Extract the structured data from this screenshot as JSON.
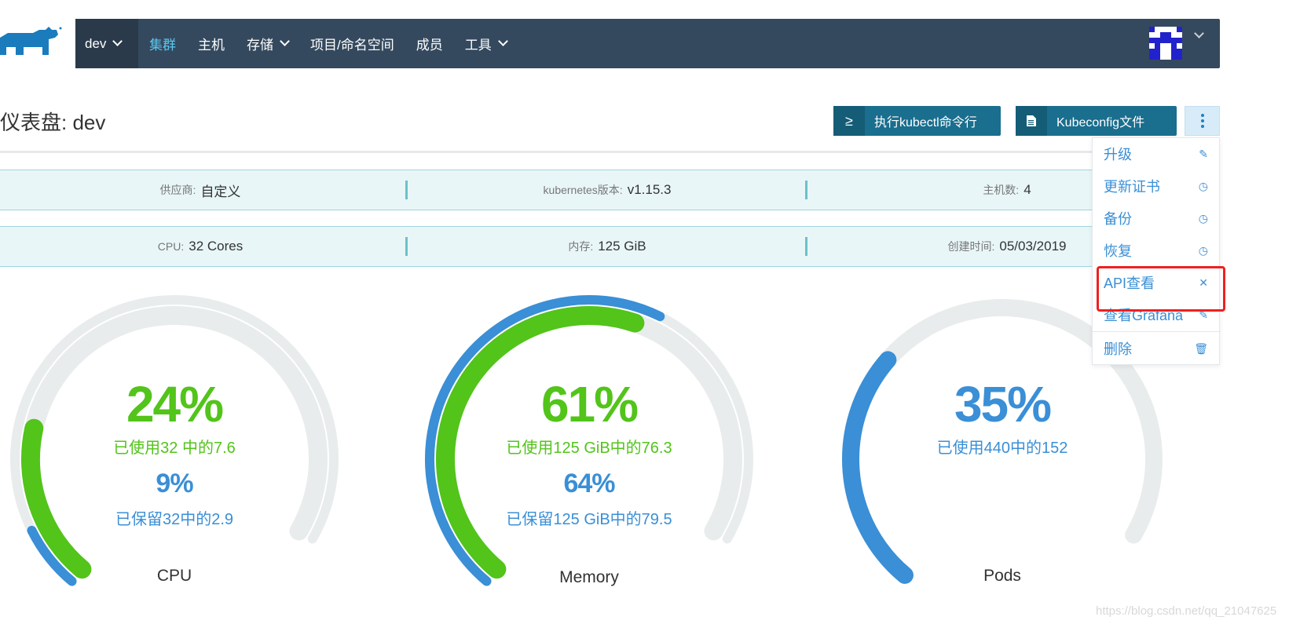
{
  "nav": {
    "env": "dev",
    "items": [
      {
        "label": "集群",
        "active": true,
        "dropdown": false
      },
      {
        "label": "主机",
        "active": false,
        "dropdown": false
      },
      {
        "label": "存储",
        "active": false,
        "dropdown": true
      },
      {
        "label": "项目/命名空间",
        "active": false,
        "dropdown": false
      },
      {
        "label": "成员",
        "active": false,
        "dropdown": false
      },
      {
        "label": "工具",
        "active": false,
        "dropdown": true
      }
    ]
  },
  "header": {
    "title": "仪表盘: dev",
    "kubectl_button": "执行kubectl命令行",
    "kubeconfig_button": "Kubeconfig文件"
  },
  "info": {
    "provider_label": "供应商:",
    "provider": "自定义",
    "k8s_label": "kubernetes版本:",
    "k8s_version": "v1.15.3",
    "hosts_label": "主机数:",
    "hosts": "4",
    "cpu_label": "CPU:",
    "cpu": "32 Cores",
    "mem_label": "内存:",
    "mem": "125 GiB",
    "created_label": "创建时间:",
    "created": "05/03/2019"
  },
  "gauges": {
    "cpu": {
      "used_pct": "24%",
      "used_text": "已使用32  中的7.6",
      "reserved_pct": "9%",
      "reserved_text": "已保留32中的2.9",
      "label": "CPU",
      "used_fraction": 0.24,
      "reserved_fraction": 0.09
    },
    "memory": {
      "used_pct": "61%",
      "used_text": "已使用125 GiB中的76.3",
      "reserved_pct": "64%",
      "reserved_text": "已保留125 GiB中的79.5",
      "label": "Memory",
      "used_fraction": 0.61,
      "reserved_fraction": 0.64
    },
    "pods": {
      "used_pct": "35%",
      "used_text": "已使用440中的152",
      "label": "Pods",
      "used_fraction": 0.35
    }
  },
  "menu": {
    "items": [
      {
        "label": "升级",
        "icon": "pencil-icon"
      },
      {
        "label": "更新证书",
        "icon": "history-icon"
      },
      {
        "label": "备份",
        "icon": "history-icon"
      },
      {
        "label": "恢复",
        "icon": "history-icon"
      },
      {
        "label": "API查看",
        "icon": "tools-icon"
      },
      {
        "label": "查看Grafana",
        "icon": "pencil-icon"
      },
      {
        "label": "删除",
        "icon": "trash-icon"
      }
    ]
  },
  "watermark": "https://blog.csdn.net/qq_21047625",
  "colors": {
    "navbar": "#34495e",
    "green": "#52c41a",
    "blue": "#3a8fd6",
    "track": "#e9ecec",
    "highlight": "#f02020"
  }
}
